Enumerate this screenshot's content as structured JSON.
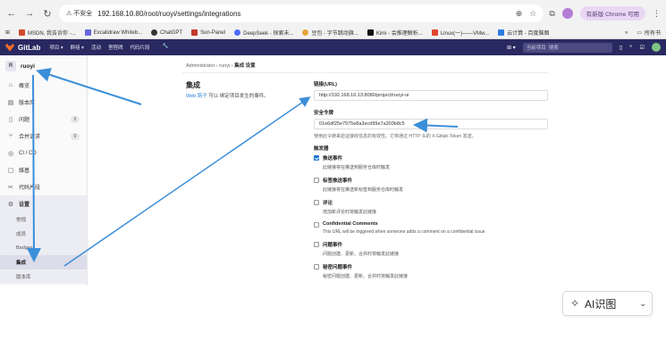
{
  "browser": {
    "insecure_label": "不安全",
    "url": "192.168.10.80/root/ruoyi/settings/integrations",
    "update_label": "有新版 Chrome 可用",
    "bookmarks": [
      "MSDN, 我告诉你 -...",
      "Excalidraw Whiteb...",
      "ChatGPT",
      "Sun-Panel",
      "DeepSeek - 探索未...",
      "豆包 - 字节跳动旗...",
      "Kimi - 会推理解析...",
      "Linux(一)——VMw...",
      "云计算 - 百度脑图"
    ],
    "bookmarks_more": "»",
    "all_bookmarks": "所有书"
  },
  "gitlab": {
    "brand": "GitLab",
    "menu": [
      "项目 ▾",
      "群组 ▾",
      "活动",
      "里程碑",
      "代码片段"
    ],
    "search_placeholder": "搜索",
    "search_scope": "当前项目"
  },
  "sidebar": {
    "project_initial": "R",
    "project_name": "ruoyi",
    "items": [
      {
        "label": "概览",
        "icon": "home-icon"
      },
      {
        "label": "版本库",
        "icon": "doc-icon"
      },
      {
        "label": "问题",
        "icon": "issues-icon",
        "badge": "0"
      },
      {
        "label": "合并请求",
        "icon": "merge-icon",
        "badge": "0"
      },
      {
        "label": "CI / CD",
        "icon": "rocket-icon"
      },
      {
        "label": "维基",
        "icon": "book-icon"
      },
      {
        "label": "代码片段",
        "icon": "scissors-icon"
      }
    ],
    "settings_label": "设置",
    "sub_items": [
      "常规",
      "成员",
      "Badges",
      "集成",
      "版本库"
    ],
    "current_sub": "集成"
  },
  "main": {
    "breadcrumb": [
      "Administrator",
      "ruoyi",
      "集成 设置"
    ],
    "title": "集成",
    "desc_link": "Web 钩子",
    "desc_text": "可以 绑定项目发生的事件。",
    "url_label": "链接(URL)",
    "url_value": "http://192.168.10.13:8080/project/ruoyi-ui",
    "token_label": "安全令牌",
    "token_value": "01e6df25e7975e8a3ecd99e7a303b8c5",
    "token_help": "使用此令牌来验证接收信息的有效性。它将通过 HTTP 头的 X-Gitlab-Token 发送。",
    "trigger_label": "触发器",
    "triggers": [
      {
        "name": "推送事件",
        "desc": "此链接将在推送到服务仓库时触发",
        "checked": true
      },
      {
        "name": "标签推送事件",
        "desc": "此链接将在推送新标签到服务仓库时触发",
        "checked": false
      },
      {
        "name": "评论",
        "desc": "增加新评论时将触发此链接",
        "checked": false
      },
      {
        "name": "Confidential Comments",
        "desc": "This URL will be triggered when someone adds a comment on a confidential issue",
        "checked": false
      },
      {
        "name": "问题事件",
        "desc": "问题创建、更新、合并时将触发此链接",
        "checked": false
      },
      {
        "name": "秘密问题事件",
        "desc": "秘密问题创建、更新、合并时将触发此链接",
        "checked": false
      }
    ]
  },
  "ai_button": {
    "label": "AI识图",
    "icon": "ai-sparkle-icon"
  },
  "colors": {
    "header": "#292961",
    "annotation_arrow": "#3b8fd9",
    "link": "#1f78d1"
  }
}
